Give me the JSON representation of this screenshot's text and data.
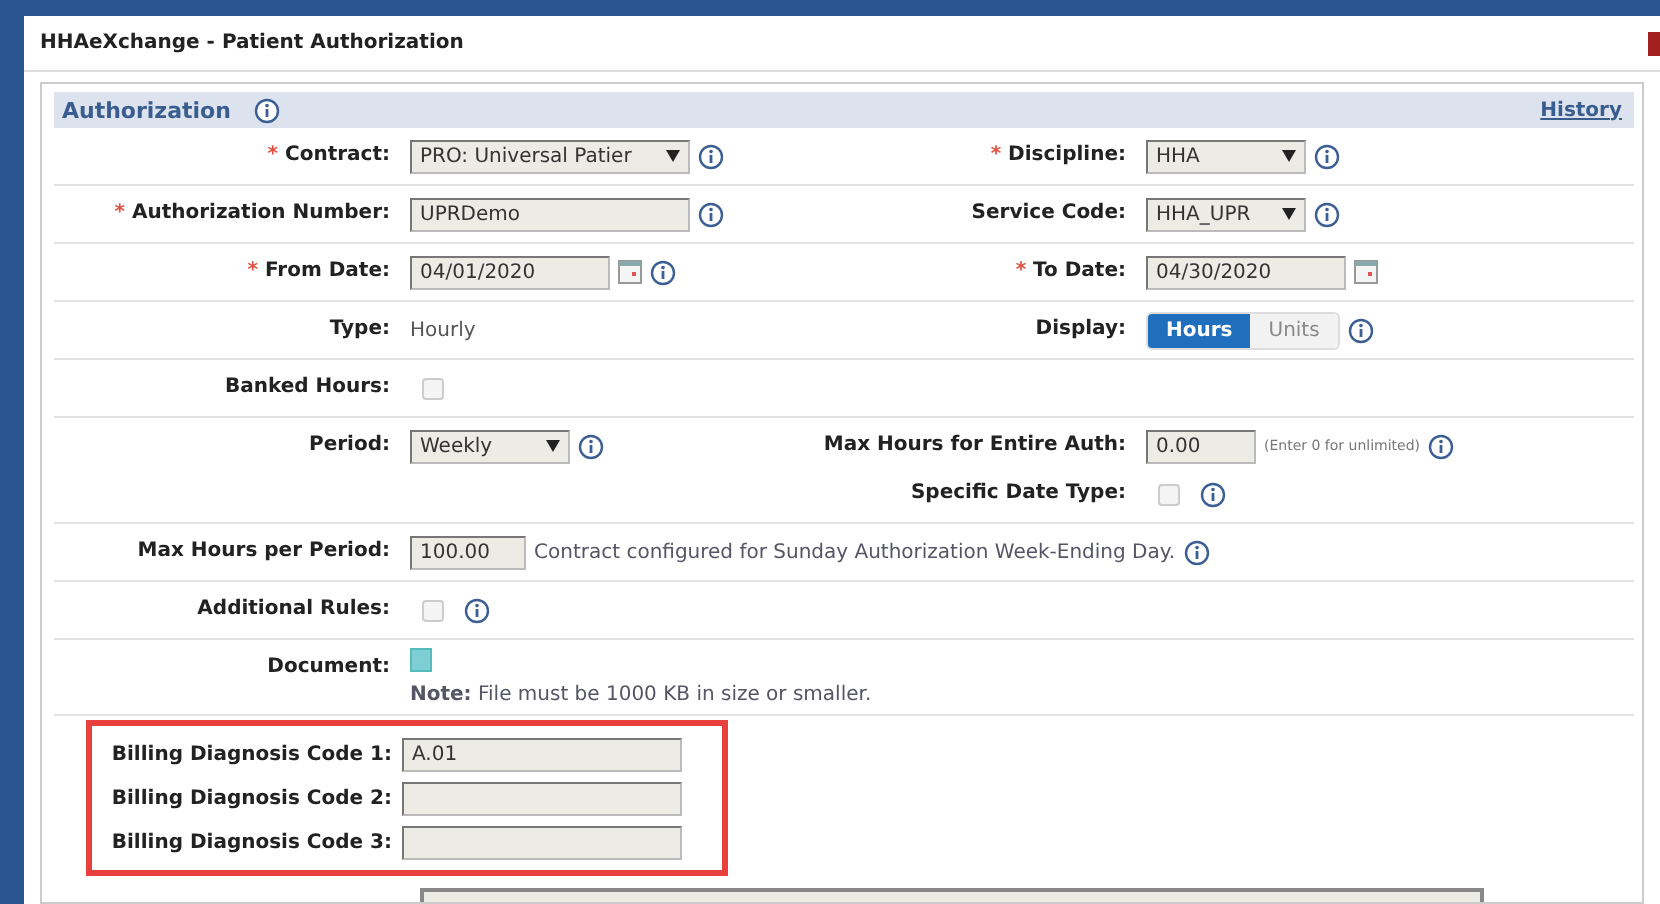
{
  "window": {
    "title": "HHAeXchange - Patient Authorization"
  },
  "section": {
    "title": "Authorization",
    "info": true,
    "link": "History"
  },
  "rows": [
    {
      "left": {
        "kind": "select",
        "star": "*",
        "label": "Contract:",
        "value": "PRO: Universal Patier",
        "info": true
      },
      "right": [
        {
          "kind": "select",
          "star": "*",
          "label": "Discipline:",
          "value": "HHA",
          "info": true
        }
      ]
    },
    {
      "left": {
        "kind": "text",
        "star": "*",
        "label": "Authorization Number:",
        "value": "UPRDemo",
        "info": true
      },
      "right": [
        {
          "kind": "select",
          "label": "Service Code:",
          "value": "HHA_UPR",
          "info": true
        }
      ]
    },
    {
      "left": {
        "kind": "date",
        "star": "*",
        "label": "From Date:",
        "value": "04/01/2020",
        "info": true
      },
      "right": [
        {
          "kind": "date",
          "star": "*",
          "label": "To Date:",
          "value": "04/30/2020"
        }
      ]
    },
    {
      "left": {
        "kind": "static",
        "label": "Type:",
        "value": "Hourly"
      },
      "right": [
        {
          "kind": "toggle",
          "label": "Display:",
          "options": [
            {
              "label": "Hours",
              "selected": true
            },
            {
              "label": "Units",
              "selected": false
            }
          ],
          "info": true
        }
      ]
    },
    {
      "left": {
        "kind": "checkbox",
        "label": "Banked Hours:",
        "checked": false
      },
      "right": []
    },
    {
      "left": {
        "kind": "select",
        "label": "Period:",
        "value": "Weekly",
        "info": true
      },
      "right": [
        {
          "kind": "text",
          "label": "Max Hours for Entire Auth:",
          "value": "0.00",
          "hint": "(Enter 0 for unlimited)",
          "info": true
        },
        {
          "kind": "checkbox",
          "label": "Specific Date Type:",
          "checked": false,
          "info": true
        }
      ]
    },
    {
      "left": {
        "kind": "text",
        "label": "Max Hours per Period:",
        "value": "100.00",
        "note": "Contract configured for Sunday Authorization Week-Ending Day.",
        "info": true
      },
      "right": []
    },
    {
      "left": {
        "kind": "checkbox",
        "label": "Additional Rules:",
        "checked": false,
        "info": true
      },
      "right": []
    },
    {
      "left": {
        "kind": "file",
        "label": "Document:",
        "note": "**Note:** File must be 1000 KB in size or smaller."
      },
      "right": []
    }
  ],
  "billing_codes": [
    {
      "label": "Billing Diagnosis Code 1:",
      "value": "A.01"
    },
    {
      "label": "Billing Diagnosis Code 2:"
    },
    {
      "label": "Billing Diagnosis Code 3:"
    }
  ]
}
